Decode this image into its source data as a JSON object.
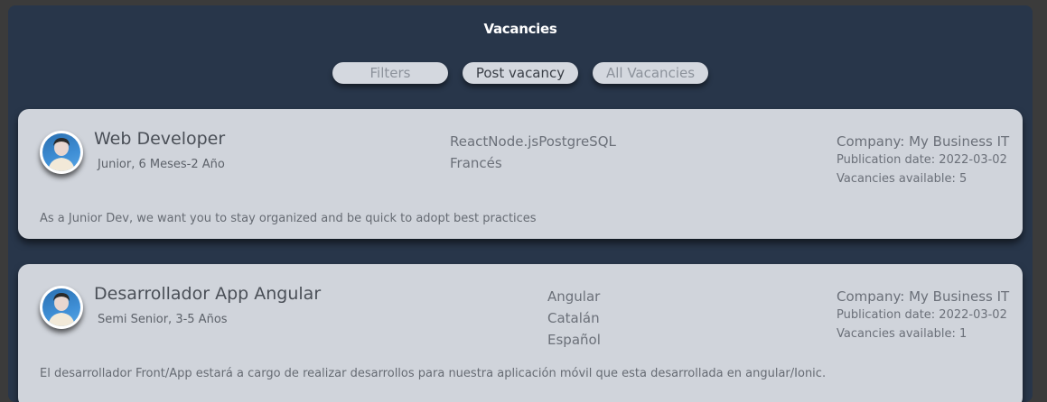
{
  "page": {
    "title": "Vacancies"
  },
  "toolbar": {
    "filters_label": "Filters",
    "post_label": "Post vacancy",
    "all_label": "All Vacancies"
  },
  "vacancies": [
    {
      "title": "Web Developer",
      "level": "Junior, 6 Meses-2 Año",
      "skills": [
        "ReactNode.jsPostgreSQL",
        "Francés"
      ],
      "company": "Company: My Business IT",
      "publication_date": "Publication date: 2022-03-02",
      "available": "Vacancies available: 5",
      "description": "As a Junior Dev, we want you to stay organized and be quick to adopt best practices"
    },
    {
      "title": "Desarrollador App Angular",
      "level": "Semi Senior, 3-5 Años",
      "skills": [
        "Angular",
        "Catalán",
        "Español"
      ],
      "company": "Company: My Business IT",
      "publication_date": "Publication date: 2022-03-02",
      "available": "Vacancies available: 1",
      "description": "El desarrollador Front/App estará a cargo de realizar desarrollos para nuestra aplicación móvil que esta desarrollada en angular/Ionic."
    }
  ]
}
